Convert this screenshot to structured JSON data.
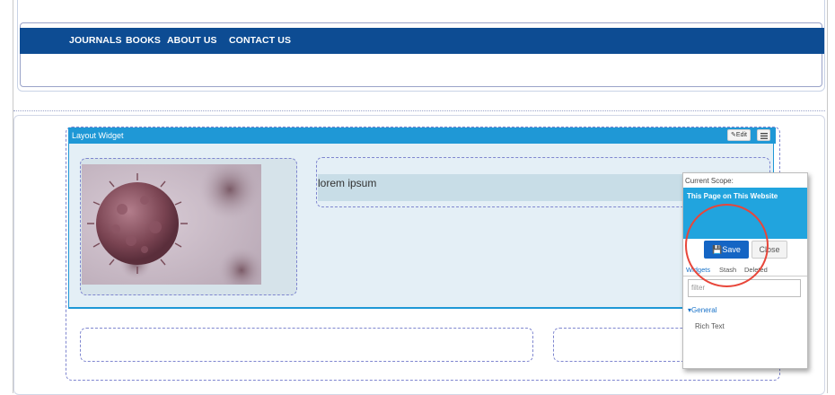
{
  "nav": {
    "items": [
      "JOURNALS",
      "BOOKS",
      "ABOUT US",
      "CONTACT US"
    ]
  },
  "layout_widget": {
    "title": "Layout Widget",
    "edit_label": "Edit",
    "menu_icon": "hamburger-icon",
    "body_text": "lorem ipsum"
  },
  "scope_panel": {
    "current_scope_label": "Current Scope:",
    "scope_value": "This Page on This Website",
    "save_label": "Save",
    "close_label": "Close",
    "tabs": [
      "Widgets",
      "Stash",
      "Deleted"
    ],
    "active_tab": "Widgets",
    "search_placeholder": "filter",
    "group_label": "General",
    "widget_item": "Rich Text"
  },
  "colors": {
    "nav_bg": "#0d4c93",
    "widget_header": "#1f98d6",
    "scope_box": "#21a4de",
    "save_button": "#1465c4",
    "highlight_circle": "#e8463a"
  }
}
